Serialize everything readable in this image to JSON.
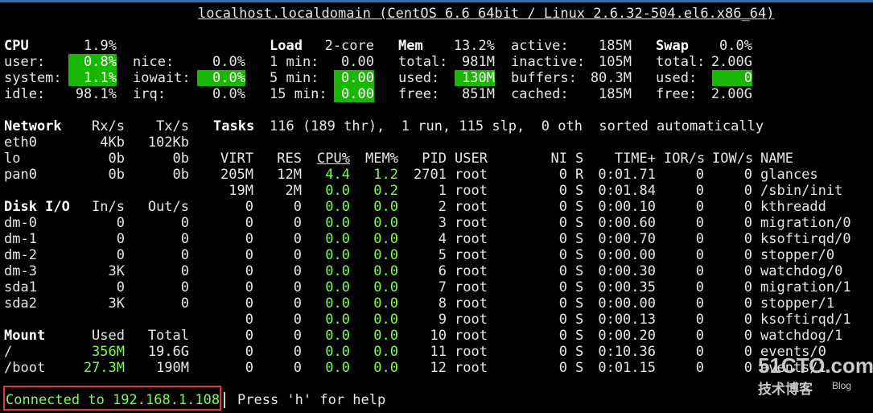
{
  "title": "localhost.localdomain (CentOS 6.6 64bit / Linux 2.6.32-504.el6.x86_64)",
  "cpu": {
    "label": "CPU",
    "total": "1.9%",
    "user_label": "user:",
    "user": "0.8%",
    "system_label": "system:",
    "system": "1.1%",
    "idle_label": "idle:",
    "idle": "98.1%",
    "nice_label": "nice:",
    "nice": "0.0%",
    "iowait_label": "iowait:",
    "iowait": "0.0%",
    "irq_label": "irq:",
    "irq": "0.0%"
  },
  "load": {
    "label": "Load",
    "cores": "2-core",
    "m1_label": "1 min:",
    "m1": "0.00",
    "m5_label": "5 min:",
    "m5": "0.00",
    "m15_label": "15 min:",
    "m15": "0.00"
  },
  "mem": {
    "label": "Mem",
    "percent": "13.2%",
    "total_label": "total:",
    "total": "981M",
    "used_label": "used:",
    "used": "130M",
    "free_label": "free:",
    "free": "851M",
    "active_label": "active:",
    "active": "185M",
    "inactive_label": "inactive:",
    "inactive": "105M",
    "buffers_label": "buffers:",
    "buffers": "80.3M",
    "cached_label": "cached:",
    "cached": "185M"
  },
  "swap": {
    "label": "Swap",
    "percent": "0.0%",
    "total_label": "total:",
    "total": "2.00G",
    "used_label": "used:",
    "used": "0",
    "free_label": "free:",
    "free": "2.00G"
  },
  "network": {
    "header": [
      "Network",
      "Rx/s",
      "Tx/s"
    ],
    "rows": [
      [
        "eth0",
        "4Kb",
        "102Kb"
      ],
      [
        "lo",
        "0b",
        "0b"
      ],
      [
        "pan0",
        "0b",
        "0b"
      ]
    ]
  },
  "tasks": {
    "label": "Tasks",
    "summary": "116 (189 thr),  1 run, 115 slp,  0 oth  sorted automatically"
  },
  "diskio": {
    "header": [
      "Disk I/O",
      "In/s",
      "Out/s"
    ],
    "rows": [
      [
        "dm-0",
        "0",
        "0"
      ],
      [
        "dm-1",
        "0",
        "0"
      ],
      [
        "dm-2",
        "0",
        "0"
      ],
      [
        "dm-3",
        "3K",
        "0"
      ],
      [
        "sda1",
        "0",
        "0"
      ],
      [
        "sda2",
        "3K",
        "0"
      ]
    ]
  },
  "mount": {
    "header": [
      "Mount",
      "Used",
      "Total"
    ],
    "rows": [
      [
        "/",
        "356M",
        "19.6G"
      ],
      [
        "/boot",
        "27.3M",
        "190M"
      ]
    ]
  },
  "proc": {
    "header": [
      "VIRT",
      "RES",
      "CPU%",
      "MEM%",
      "PID",
      "USER",
      "NI",
      "S",
      "TIME+",
      "IOR/s",
      "IOW/s",
      "NAME"
    ],
    "rows": [
      [
        "205M",
        "12M",
        "4.4",
        "1.2",
        "2701",
        "root",
        "0",
        "R",
        "0:01.71",
        "0",
        "0",
        "glances"
      ],
      [
        "19M",
        "2M",
        "0.0",
        "0.2",
        "1",
        "root",
        "0",
        "S",
        "0:01.84",
        "0",
        "0",
        "/sbin/init"
      ],
      [
        "0",
        "0",
        "0.0",
        "0.0",
        "2",
        "root",
        "0",
        "S",
        "0:00.10",
        "0",
        "0",
        "kthreadd"
      ],
      [
        "0",
        "0",
        "0.0",
        "0.0",
        "3",
        "root",
        "0",
        "S",
        "0:00.60",
        "0",
        "0",
        "migration/0"
      ],
      [
        "0",
        "0",
        "0.0",
        "0.0",
        "4",
        "root",
        "0",
        "S",
        "0:00.70",
        "0",
        "0",
        "ksoftirqd/0"
      ],
      [
        "0",
        "0",
        "0.0",
        "0.0",
        "5",
        "root",
        "0",
        "S",
        "0:00.00",
        "0",
        "0",
        "stopper/0"
      ],
      [
        "0",
        "0",
        "0.0",
        "0.0",
        "6",
        "root",
        "0",
        "S",
        "0:00.30",
        "0",
        "0",
        "watchdog/0"
      ],
      [
        "0",
        "0",
        "0.0",
        "0.0",
        "7",
        "root",
        "0",
        "S",
        "0:00.35",
        "0",
        "0",
        "migration/1"
      ],
      [
        "0",
        "0",
        "0.0",
        "0.0",
        "8",
        "root",
        "0",
        "S",
        "0:00.00",
        "0",
        "0",
        "stopper/1"
      ],
      [
        "0",
        "0",
        "0.0",
        "0.0",
        "9",
        "root",
        "0",
        "S",
        "0:00.13",
        "0",
        "0",
        "ksoftirqd/1"
      ],
      [
        "0",
        "0",
        "0.0",
        "0.0",
        "10",
        "root",
        "0",
        "S",
        "0:00.20",
        "0",
        "0",
        "watchdog/1"
      ],
      [
        "0",
        "0",
        "0.0",
        "0.0",
        "11",
        "root",
        "0",
        "S",
        "0:10.36",
        "0",
        "0",
        "events/0"
      ],
      [
        "0",
        "0",
        "0.0",
        "0.0",
        "12",
        "root",
        "0",
        "S",
        "0:01.15",
        "0",
        "0",
        "events/1"
      ]
    ]
  },
  "status": {
    "connected": "Connected to 192.168.1.108",
    "help": "Press 'h' for help"
  },
  "watermark": {
    "site": "51CTO.com",
    "sub": "技术博客",
    "blog": "Blog"
  },
  "colors": {
    "background": "#000000",
    "text": "#e6e6e6",
    "value_green": "#7cfc4a",
    "highlight_green": "#19b800",
    "status_border": "#e23a3a"
  }
}
